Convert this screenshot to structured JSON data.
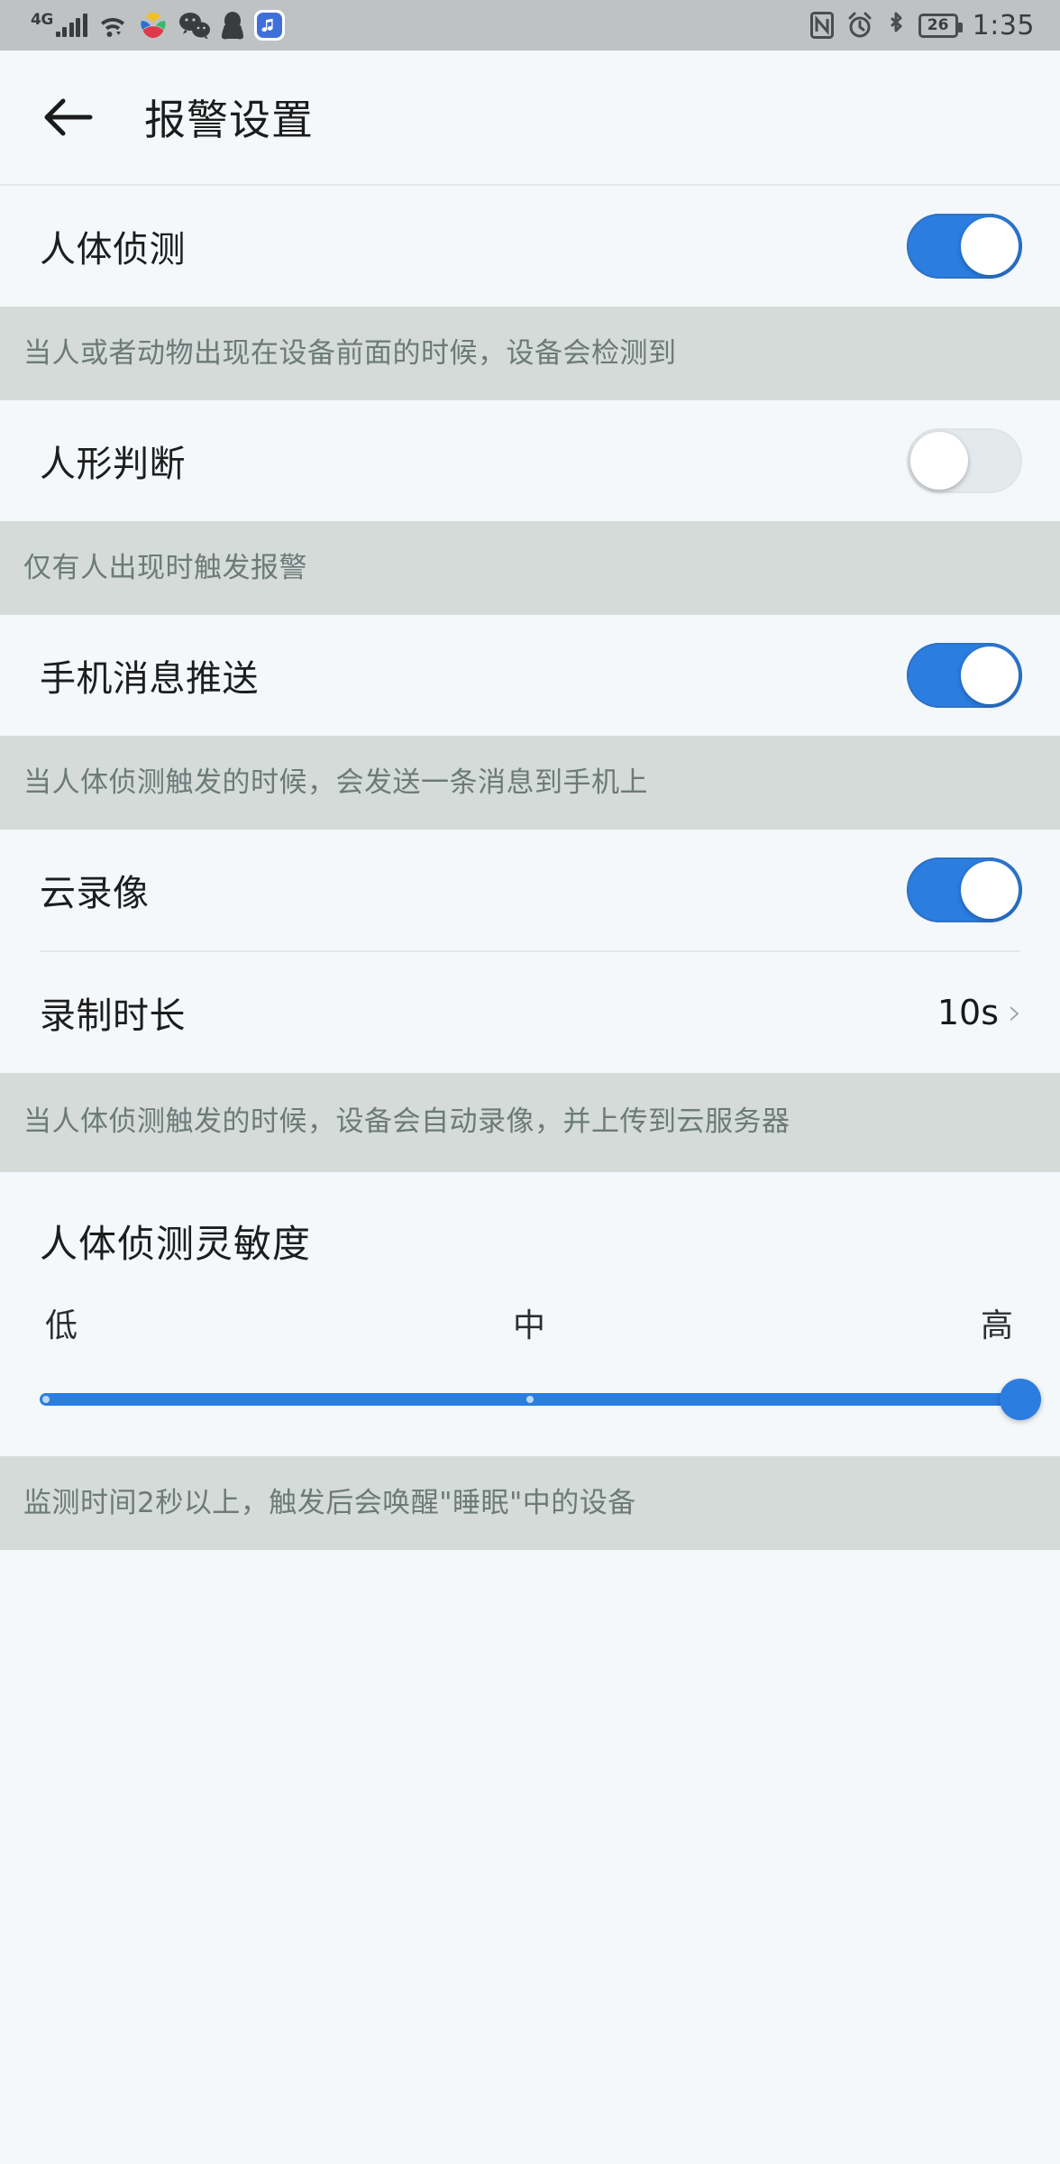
{
  "statusbar": {
    "network_label": "4G",
    "battery_percent": "26",
    "time": "1:35",
    "left_icons": [
      "signal-4g-icon",
      "wifi-icon",
      "color-flower-app-icon",
      "wechat-icon",
      "qq-penguin-icon",
      "music-app-icon"
    ],
    "right_icons": [
      "nfc-icon",
      "alarm-clock-icon",
      "bluetooth-icon",
      "battery-icon"
    ]
  },
  "header": {
    "title": "报警设置",
    "back_icon": "back-arrow-icon"
  },
  "rows": {
    "human_detect": {
      "label": "人体侦测",
      "toggle": "on"
    },
    "human_detect_hint": "当人或者动物出现在设备前面的时候，设备会检测到",
    "human_shape": {
      "label": "人形判断",
      "toggle": "off"
    },
    "human_shape_hint": "仅有人出现时触发报警",
    "push": {
      "label": "手机消息推送",
      "toggle": "on"
    },
    "push_hint": "当人体侦测触发的时候，会发送一条消息到手机上",
    "cloud_record": {
      "label": "云录像",
      "toggle": "on"
    },
    "record_duration": {
      "label": "录制时长",
      "value": "10s",
      "chevron": "›"
    },
    "cloud_record_hint": "当人体侦测触发的时候，设备会自动录像，并上传到云服务器"
  },
  "sensitivity": {
    "title": "人体侦测灵敏度",
    "low_label": "低",
    "mid_label": "中",
    "high_label": "高",
    "value": "高",
    "hint": "监测时间2秒以上，触发后会唤醒\"睡眠\"中的设备"
  },
  "colors": {
    "accent": "#2b7de0",
    "hint_bg": "#d4dbd9",
    "row_bg": "#f4f8fb",
    "statusbar_bg": "#bfc2c2"
  }
}
